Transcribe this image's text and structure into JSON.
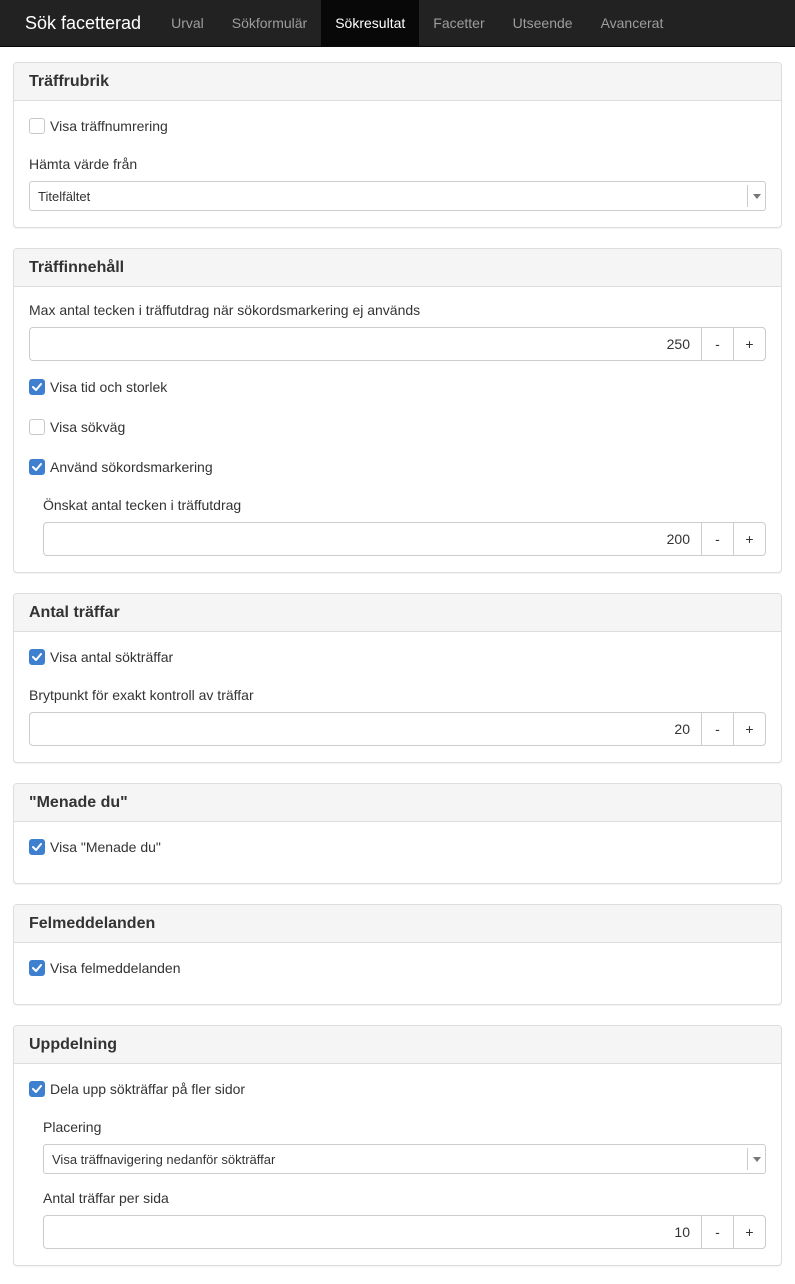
{
  "nav": {
    "brand": "Sök facetterad",
    "tabs": [
      "Urval",
      "Sökformulär",
      "Sökresultat",
      "Facetter",
      "Utseende",
      "Avancerat"
    ],
    "active_tab": "Sökresultat"
  },
  "colors": {
    "accent": "#3f7fd0",
    "navbar": "#222222"
  },
  "hit_heading": {
    "title": "Träffrubrik",
    "show_numbering_label": "Visa träffnumrering",
    "show_numbering_checked": false,
    "value_from_label": "Hämta värde från",
    "value_from_selected": "Titelfältet"
  },
  "hit_content": {
    "title": "Träffinnehåll",
    "max_chars_label": "Max antal tecken i träffutdrag när sökordsmarkering ej används",
    "max_chars_value": "250",
    "show_time_size_label": "Visa tid och storlek",
    "show_time_size_checked": true,
    "show_path_label": "Visa sökväg",
    "show_path_checked": false,
    "use_highlight_label": "Använd sökordsmarkering",
    "use_highlight_checked": true,
    "desired_chars_label": "Önskat antal tecken i träffutdrag",
    "desired_chars_value": "200"
  },
  "hit_count": {
    "title": "Antal träffar",
    "show_count_label": "Visa antal sökträffar",
    "show_count_checked": true,
    "breakpoint_label": "Brytpunkt för exakt kontroll av träffar",
    "breakpoint_value": "20"
  },
  "did_you_mean": {
    "title": "\"Menade du\"",
    "show_label": "Visa \"Menade du\"",
    "show_checked": true
  },
  "errors": {
    "title": "Felmeddelanden",
    "show_label": "Visa felmeddelanden",
    "show_checked": true
  },
  "paging": {
    "title": "Uppdelning",
    "split_label": "Dela upp sökträffar på fler sidor",
    "split_checked": true,
    "placement_label": "Placering",
    "placement_selected": "Visa träffnavigering nedanför sökträffar",
    "per_page_label": "Antal träffar per sida",
    "per_page_value": "10"
  },
  "stepper": {
    "minus": "-",
    "plus": "+"
  }
}
